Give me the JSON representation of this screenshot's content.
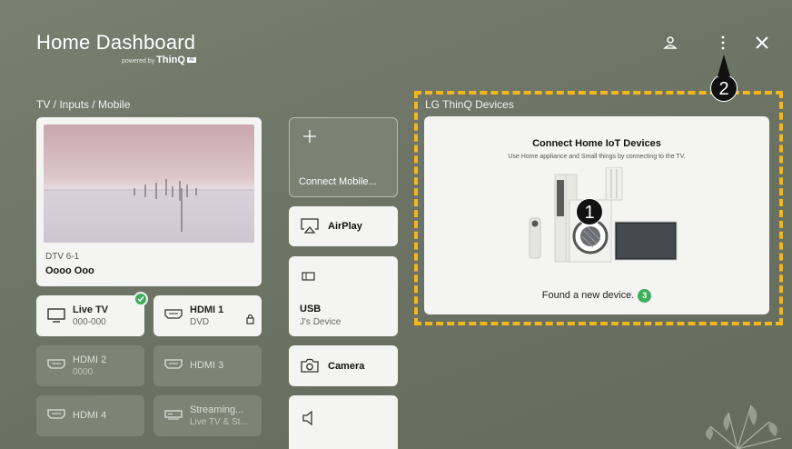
{
  "header": {
    "title": "Home Dashboard",
    "powered_prefix": "powered by",
    "powered_brand": "ThinQ",
    "powered_badge": "AI"
  },
  "icons": {
    "profile": "user-icon",
    "menu": "more-vertical-icon",
    "close": "close-icon"
  },
  "sections": {
    "inputs_label": "TV / Inputs / Mobile",
    "thinq_label": "LG ThinQ Devices"
  },
  "tv": {
    "channel": "DTV 6-1",
    "program": "Oooo Ooo"
  },
  "inputs": [
    {
      "label": "Live TV",
      "sub": "000-000",
      "active": true,
      "connected": true
    },
    {
      "label": "HDMI 1",
      "sub": "DVD",
      "active": true,
      "connected": false
    },
    {
      "label": "HDMI 2",
      "sub": "0000",
      "active": false
    },
    {
      "label": "HDMI 3",
      "sub": "",
      "active": false
    },
    {
      "label": "HDMI 4",
      "sub": "",
      "active": false
    },
    {
      "label": "Streaming...",
      "sub": "Live TV & St...",
      "active": false
    }
  ],
  "side": {
    "connect_mobile": "Connect Mobile...",
    "airplay": "AirPlay",
    "usb": "USB",
    "usb_sub": "J's Device",
    "camera": "Camera"
  },
  "thinq": {
    "title": "Connect Home IoT Devices",
    "subtitle": "Use Home appliance and Small things by connecting to the TV.",
    "found": "Found a new device.",
    "found_count": "3"
  },
  "markers": {
    "one": "1",
    "two": "2"
  },
  "colors": {
    "highlight": "#f1b71c",
    "status_green": "#3fae5a",
    "background": "#6f7566"
  }
}
